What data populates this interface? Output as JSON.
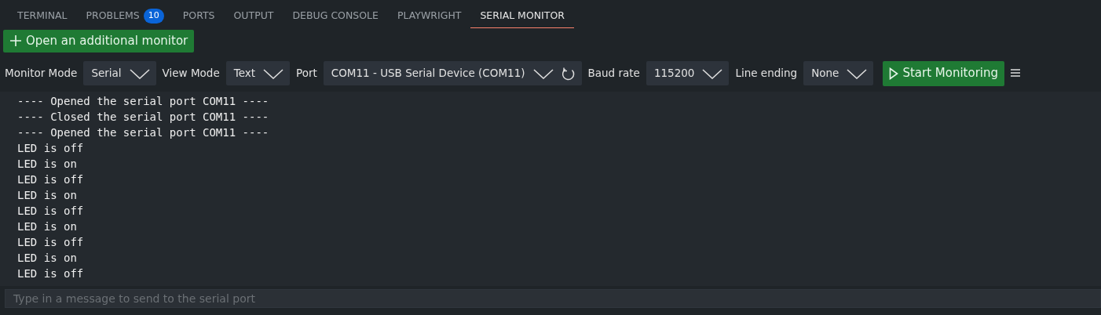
{
  "tabs": [
    {
      "label": "TERMINAL",
      "selected": false
    },
    {
      "label": "PROBLEMS",
      "badge": "10",
      "selected": false
    },
    {
      "label": "PORTS",
      "selected": false
    },
    {
      "label": "OUTPUT",
      "selected": false
    },
    {
      "label": "DEBUG CONSOLE",
      "selected": false
    },
    {
      "label": "PLAYWRIGHT",
      "selected": false
    },
    {
      "label": "SERIAL MONITOR",
      "selected": true
    }
  ],
  "open_button": {
    "label": "Open an additional monitor"
  },
  "toolbar": [
    {
      "kind": "select",
      "label": "Monitor Mode",
      "value": "Serial"
    },
    {
      "kind": "select",
      "label": "View Mode",
      "value": "Text"
    },
    {
      "kind": "select",
      "label": "Port",
      "value": "COM11 - USB Serial Device (COM11)",
      "refresh": true
    },
    {
      "kind": "select",
      "label": "Baud rate",
      "value": "115200"
    },
    {
      "kind": "select",
      "label": "Line ending",
      "value": "None"
    }
  ],
  "start_button": {
    "label": "Start Monitoring"
  },
  "log": [
    "---- Opened the serial port COM11 ----",
    "---- Closed the serial port COM11 ----",
    "---- Opened the serial port COM11 ----",
    "LED is off",
    "LED is on",
    "LED is off",
    "LED is on",
    "LED is off",
    "LED is on",
    "LED is off",
    "LED is on",
    "LED is off"
  ],
  "message_input": {
    "placeholder": "Type in a message to send to the serial port"
  }
}
